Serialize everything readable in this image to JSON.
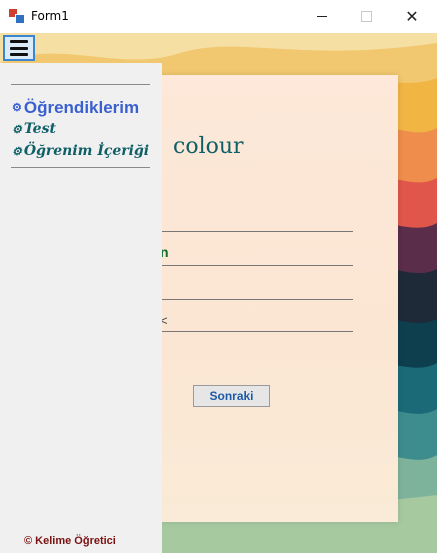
{
  "window": {
    "title": "Form1",
    "minimize_label": "–",
    "close_label": "✕"
  },
  "menu": {
    "items": [
      {
        "label": "Öğrendiklerim",
        "icon": "gear-icon"
      },
      {
        "label": "Test",
        "icon": "gear-icon"
      },
      {
        "label": "Öğrenim İçeriği",
        "icon": "gear-icon"
      }
    ],
    "footer": "© Kelime Öğretici"
  },
  "main": {
    "word": "colour",
    "fragment_1": "n",
    "fragment_2": "<",
    "next_button": "Sonraki"
  },
  "colors": {
    "accent": "#0f5f66",
    "menu_highlight": "#3a5fd0",
    "footer": "#7a1010"
  }
}
